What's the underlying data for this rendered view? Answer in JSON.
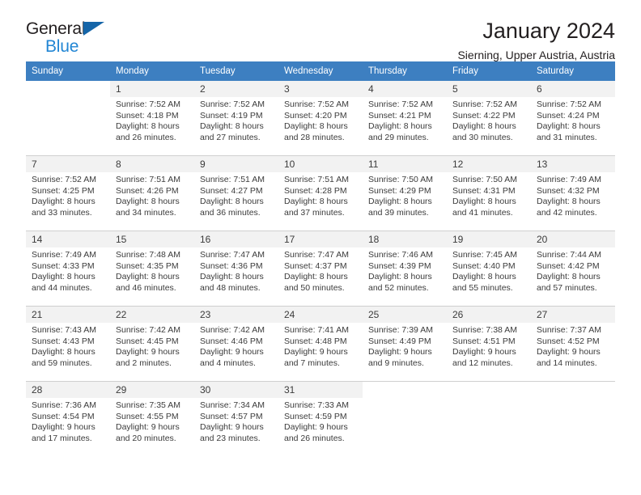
{
  "brand": {
    "name_top": "General",
    "name_bottom": "Blue",
    "triangle_color": "#1565a8",
    "bottom_color": "#2286d4"
  },
  "header": {
    "title": "January 2024",
    "subtitle": "Sierning, Upper Austria, Austria"
  },
  "theme": {
    "header_row_bg": "#3d7fc1",
    "daynum_bg": "#f2f2f2",
    "divider": "#cfcfcf",
    "text": "#3b3b3b"
  },
  "calendar": {
    "weekday_headers": [
      "Sunday",
      "Monday",
      "Tuesday",
      "Wednesday",
      "Thursday",
      "Friday",
      "Saturday"
    ],
    "weeks": [
      {
        "days": [
          {
            "number": "",
            "empty": true,
            "sunrise": "",
            "sunset": "",
            "daylight_line1": "",
            "daylight_line2": ""
          },
          {
            "number": "1",
            "empty": false,
            "sunrise": "Sunrise: 7:52 AM",
            "sunset": "Sunset: 4:18 PM",
            "daylight_line1": "Daylight: 8 hours",
            "daylight_line2": "and 26 minutes."
          },
          {
            "number": "2",
            "empty": false,
            "sunrise": "Sunrise: 7:52 AM",
            "sunset": "Sunset: 4:19 PM",
            "daylight_line1": "Daylight: 8 hours",
            "daylight_line2": "and 27 minutes."
          },
          {
            "number": "3",
            "empty": false,
            "sunrise": "Sunrise: 7:52 AM",
            "sunset": "Sunset: 4:20 PM",
            "daylight_line1": "Daylight: 8 hours",
            "daylight_line2": "and 28 minutes."
          },
          {
            "number": "4",
            "empty": false,
            "sunrise": "Sunrise: 7:52 AM",
            "sunset": "Sunset: 4:21 PM",
            "daylight_line1": "Daylight: 8 hours",
            "daylight_line2": "and 29 minutes."
          },
          {
            "number": "5",
            "empty": false,
            "sunrise": "Sunrise: 7:52 AM",
            "sunset": "Sunset: 4:22 PM",
            "daylight_line1": "Daylight: 8 hours",
            "daylight_line2": "and 30 minutes."
          },
          {
            "number": "6",
            "empty": false,
            "sunrise": "Sunrise: 7:52 AM",
            "sunset": "Sunset: 4:24 PM",
            "daylight_line1": "Daylight: 8 hours",
            "daylight_line2": "and 31 minutes."
          }
        ]
      },
      {
        "days": [
          {
            "number": "7",
            "empty": false,
            "sunrise": "Sunrise: 7:52 AM",
            "sunset": "Sunset: 4:25 PM",
            "daylight_line1": "Daylight: 8 hours",
            "daylight_line2": "and 33 minutes."
          },
          {
            "number": "8",
            "empty": false,
            "sunrise": "Sunrise: 7:51 AM",
            "sunset": "Sunset: 4:26 PM",
            "daylight_line1": "Daylight: 8 hours",
            "daylight_line2": "and 34 minutes."
          },
          {
            "number": "9",
            "empty": false,
            "sunrise": "Sunrise: 7:51 AM",
            "sunset": "Sunset: 4:27 PM",
            "daylight_line1": "Daylight: 8 hours",
            "daylight_line2": "and 36 minutes."
          },
          {
            "number": "10",
            "empty": false,
            "sunrise": "Sunrise: 7:51 AM",
            "sunset": "Sunset: 4:28 PM",
            "daylight_line1": "Daylight: 8 hours",
            "daylight_line2": "and 37 minutes."
          },
          {
            "number": "11",
            "empty": false,
            "sunrise": "Sunrise: 7:50 AM",
            "sunset": "Sunset: 4:29 PM",
            "daylight_line1": "Daylight: 8 hours",
            "daylight_line2": "and 39 minutes."
          },
          {
            "number": "12",
            "empty": false,
            "sunrise": "Sunrise: 7:50 AM",
            "sunset": "Sunset: 4:31 PM",
            "daylight_line1": "Daylight: 8 hours",
            "daylight_line2": "and 41 minutes."
          },
          {
            "number": "13",
            "empty": false,
            "sunrise": "Sunrise: 7:49 AM",
            "sunset": "Sunset: 4:32 PM",
            "daylight_line1": "Daylight: 8 hours",
            "daylight_line2": "and 42 minutes."
          }
        ]
      },
      {
        "days": [
          {
            "number": "14",
            "empty": false,
            "sunrise": "Sunrise: 7:49 AM",
            "sunset": "Sunset: 4:33 PM",
            "daylight_line1": "Daylight: 8 hours",
            "daylight_line2": "and 44 minutes."
          },
          {
            "number": "15",
            "empty": false,
            "sunrise": "Sunrise: 7:48 AM",
            "sunset": "Sunset: 4:35 PM",
            "daylight_line1": "Daylight: 8 hours",
            "daylight_line2": "and 46 minutes."
          },
          {
            "number": "16",
            "empty": false,
            "sunrise": "Sunrise: 7:47 AM",
            "sunset": "Sunset: 4:36 PM",
            "daylight_line1": "Daylight: 8 hours",
            "daylight_line2": "and 48 minutes."
          },
          {
            "number": "17",
            "empty": false,
            "sunrise": "Sunrise: 7:47 AM",
            "sunset": "Sunset: 4:37 PM",
            "daylight_line1": "Daylight: 8 hours",
            "daylight_line2": "and 50 minutes."
          },
          {
            "number": "18",
            "empty": false,
            "sunrise": "Sunrise: 7:46 AM",
            "sunset": "Sunset: 4:39 PM",
            "daylight_line1": "Daylight: 8 hours",
            "daylight_line2": "and 52 minutes."
          },
          {
            "number": "19",
            "empty": false,
            "sunrise": "Sunrise: 7:45 AM",
            "sunset": "Sunset: 4:40 PM",
            "daylight_line1": "Daylight: 8 hours",
            "daylight_line2": "and 55 minutes."
          },
          {
            "number": "20",
            "empty": false,
            "sunrise": "Sunrise: 7:44 AM",
            "sunset": "Sunset: 4:42 PM",
            "daylight_line1": "Daylight: 8 hours",
            "daylight_line2": "and 57 minutes."
          }
        ]
      },
      {
        "days": [
          {
            "number": "21",
            "empty": false,
            "sunrise": "Sunrise: 7:43 AM",
            "sunset": "Sunset: 4:43 PM",
            "daylight_line1": "Daylight: 8 hours",
            "daylight_line2": "and 59 minutes."
          },
          {
            "number": "22",
            "empty": false,
            "sunrise": "Sunrise: 7:42 AM",
            "sunset": "Sunset: 4:45 PM",
            "daylight_line1": "Daylight: 9 hours",
            "daylight_line2": "and 2 minutes."
          },
          {
            "number": "23",
            "empty": false,
            "sunrise": "Sunrise: 7:42 AM",
            "sunset": "Sunset: 4:46 PM",
            "daylight_line1": "Daylight: 9 hours",
            "daylight_line2": "and 4 minutes."
          },
          {
            "number": "24",
            "empty": false,
            "sunrise": "Sunrise: 7:41 AM",
            "sunset": "Sunset: 4:48 PM",
            "daylight_line1": "Daylight: 9 hours",
            "daylight_line2": "and 7 minutes."
          },
          {
            "number": "25",
            "empty": false,
            "sunrise": "Sunrise: 7:39 AM",
            "sunset": "Sunset: 4:49 PM",
            "daylight_line1": "Daylight: 9 hours",
            "daylight_line2": "and 9 minutes."
          },
          {
            "number": "26",
            "empty": false,
            "sunrise": "Sunrise: 7:38 AM",
            "sunset": "Sunset: 4:51 PM",
            "daylight_line1": "Daylight: 9 hours",
            "daylight_line2": "and 12 minutes."
          },
          {
            "number": "27",
            "empty": false,
            "sunrise": "Sunrise: 7:37 AM",
            "sunset": "Sunset: 4:52 PM",
            "daylight_line1": "Daylight: 9 hours",
            "daylight_line2": "and 14 minutes."
          }
        ]
      },
      {
        "days": [
          {
            "number": "28",
            "empty": false,
            "sunrise": "Sunrise: 7:36 AM",
            "sunset": "Sunset: 4:54 PM",
            "daylight_line1": "Daylight: 9 hours",
            "daylight_line2": "and 17 minutes."
          },
          {
            "number": "29",
            "empty": false,
            "sunrise": "Sunrise: 7:35 AM",
            "sunset": "Sunset: 4:55 PM",
            "daylight_line1": "Daylight: 9 hours",
            "daylight_line2": "and 20 minutes."
          },
          {
            "number": "30",
            "empty": false,
            "sunrise": "Sunrise: 7:34 AM",
            "sunset": "Sunset: 4:57 PM",
            "daylight_line1": "Daylight: 9 hours",
            "daylight_line2": "and 23 minutes."
          },
          {
            "number": "31",
            "empty": false,
            "sunrise": "Sunrise: 7:33 AM",
            "sunset": "Sunset: 4:59 PM",
            "daylight_line1": "Daylight: 9 hours",
            "daylight_line2": "and 26 minutes."
          },
          {
            "number": "",
            "empty": true,
            "sunrise": "",
            "sunset": "",
            "daylight_line1": "",
            "daylight_line2": ""
          },
          {
            "number": "",
            "empty": true,
            "sunrise": "",
            "sunset": "",
            "daylight_line1": "",
            "daylight_line2": ""
          },
          {
            "number": "",
            "empty": true,
            "sunrise": "",
            "sunset": "",
            "daylight_line1": "",
            "daylight_line2": ""
          }
        ]
      }
    ]
  }
}
